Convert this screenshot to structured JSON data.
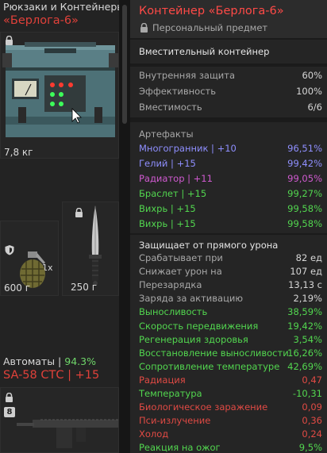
{
  "inventory": {
    "category1_title": "Рюкзаки и Контейнеры",
    "container_name": "«Берлога-6»",
    "container_weight": "7,8 кг",
    "grenade_qty": "1x",
    "grenade_weight": "600 г",
    "knife_weight": "250 г",
    "category2_prefix": "Автоматы | ",
    "category2_percent": "94.3%",
    "rifle_name": "SA-58 СТС | +15",
    "slot_number": "8"
  },
  "tooltip": {
    "title": "Контейнер «Берлога-6»",
    "subtitle": "Персональный предмет",
    "description": "Вместительный контейнер",
    "stats": [
      {
        "label": "Внутренняя защита",
        "value": "60%"
      },
      {
        "label": "Эффективность",
        "value": "100%"
      },
      {
        "label": "Вместимость",
        "value": "6/6"
      }
    ],
    "artifacts_title": "Артефакты",
    "artifacts": [
      {
        "label": "Многогранник | +10",
        "value": "96,51%",
        "color": "#8f8fff"
      },
      {
        "label": "Гелий | +15",
        "value": "99,42%",
        "color": "#8f8fff"
      },
      {
        "label": "Радиатор | +11",
        "value": "99,05%",
        "color": "#d05ad0"
      },
      {
        "label": "Браслет | +15",
        "value": "99,27%",
        "color": "#52d64f"
      },
      {
        "label": "Вихрь | +15",
        "value": "99,58%",
        "color": "#52d64f"
      },
      {
        "label": "Вихрь | +15",
        "value": "99,58%",
        "color": "#52d64f"
      }
    ],
    "protection_title": "Защищает от прямого урона",
    "protection": [
      {
        "label": "Срабатывает при",
        "value": "82 ед",
        "color": "#a8a8a8",
        "vcolor": "#d6d6d6"
      },
      {
        "label": "Снижает урон на",
        "value": "107 ед",
        "color": "#a8a8a8",
        "vcolor": "#d6d6d6"
      },
      {
        "label": "Перезарядка",
        "value": "13,13 с",
        "color": "#a8a8a8",
        "vcolor": "#d6d6d6"
      },
      {
        "label": "Заряда за активацию",
        "value": "2,19%",
        "color": "#a8a8a8",
        "vcolor": "#d6d6d6"
      },
      {
        "label": "Выносливость",
        "value": "38,59%",
        "color": "#52d64f",
        "vcolor": "#52d64f"
      },
      {
        "label": "Скорость передвижения",
        "value": "19,42%",
        "color": "#52d64f",
        "vcolor": "#52d64f"
      },
      {
        "label": "Регенерация здоровья",
        "value": "3,54%",
        "color": "#52d64f",
        "vcolor": "#52d64f"
      },
      {
        "label": "Восстановление выносливости",
        "value": "16,26%",
        "color": "#52d64f",
        "vcolor": "#52d64f"
      },
      {
        "label": "Сопротивление температуре",
        "value": "42,69%",
        "color": "#52d64f",
        "vcolor": "#52d64f"
      },
      {
        "label": "Радиация",
        "value": "0,47",
        "color": "#e04a44",
        "vcolor": "#e04a44"
      },
      {
        "label": "Температура",
        "value": "-10,31",
        "color": "#52d64f",
        "vcolor": "#52d64f"
      },
      {
        "label": "Биологическое заражение",
        "value": "0,09",
        "color": "#e04a44",
        "vcolor": "#e04a44"
      },
      {
        "label": "Пси-излучение",
        "value": "0,36",
        "color": "#e04a44",
        "vcolor": "#e04a44"
      },
      {
        "label": "Холод",
        "value": "0,24",
        "color": "#e04a44",
        "vcolor": "#e04a44"
      },
      {
        "label": "Реакция на ожог",
        "value": "9,5%",
        "color": "#52d64f",
        "vcolor": "#52d64f"
      }
    ]
  }
}
